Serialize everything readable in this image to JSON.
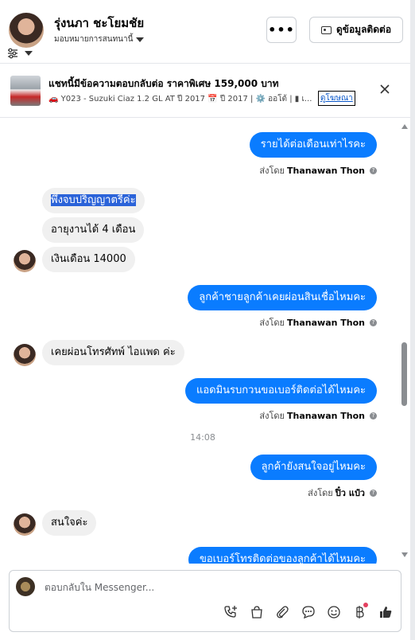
{
  "header": {
    "contact_name": "รุ่งนภา ชะโยมชัย",
    "assign_label": "มอบหมายการสนทนานี้",
    "more_label": "•••",
    "contact_info_label": "ดูข้อมูลติดต่อ"
  },
  "banner": {
    "title": "แชทนี้มีข้อความตอบกลับต่อ ราคาพิเศษ 159,000 บาท",
    "detail": "🚗 Y023 - Suzuki Ciaz 1.2 GL AT ปี 2017 📅 ปี 2017 | ⚙️ ออโต้ | ▮ เ...",
    "ad_link": "ดูโฆษณา"
  },
  "messages": {
    "m1": "รายได้ต่อเดือนเท่าไรคะ",
    "m1_sent_prefix": "ส่งโดย",
    "m1_sender": "Thanawan Thon",
    "m2": "พึ่งจบปริญญาตรีค่ะ",
    "m3": "อายุงานได้ 4 เดือน",
    "m4": "เงินเดือน 14000",
    "m5": "ลูกค้าชายลูกค้าเคยผ่อนสินเชื่อไหมคะ",
    "m5_sent_prefix": "ส่งโดย",
    "m5_sender": "Thanawan Thon",
    "m6": "เคยผ่อนโทรศัทพ์ ไอแพด ค่ะ",
    "m7": "แอดมินรบกวนขอเบอร์ติดต่อได้ไหมคะ",
    "m7_sent_prefix": "ส่งโดย",
    "m7_sender": "Thanawan Thon",
    "time": "14:08",
    "m8": "ลูกค้ายังสนใจอยู่ไหมคะ",
    "m8_sent_prefix": "ส่งโดย",
    "m8_sender": "ปิ๋ว แป๋ว",
    "m9": "สนใจค่ะ",
    "m10": "ขอเบอร์โทรติดต่อของลูกค้าได้ไหมคะ"
  },
  "composer": {
    "placeholder": "ตอบกลับใน Messenger..."
  },
  "colors": {
    "outgoing_bubble": "#0a7cff",
    "incoming_bubble": "#f0f0f0"
  }
}
